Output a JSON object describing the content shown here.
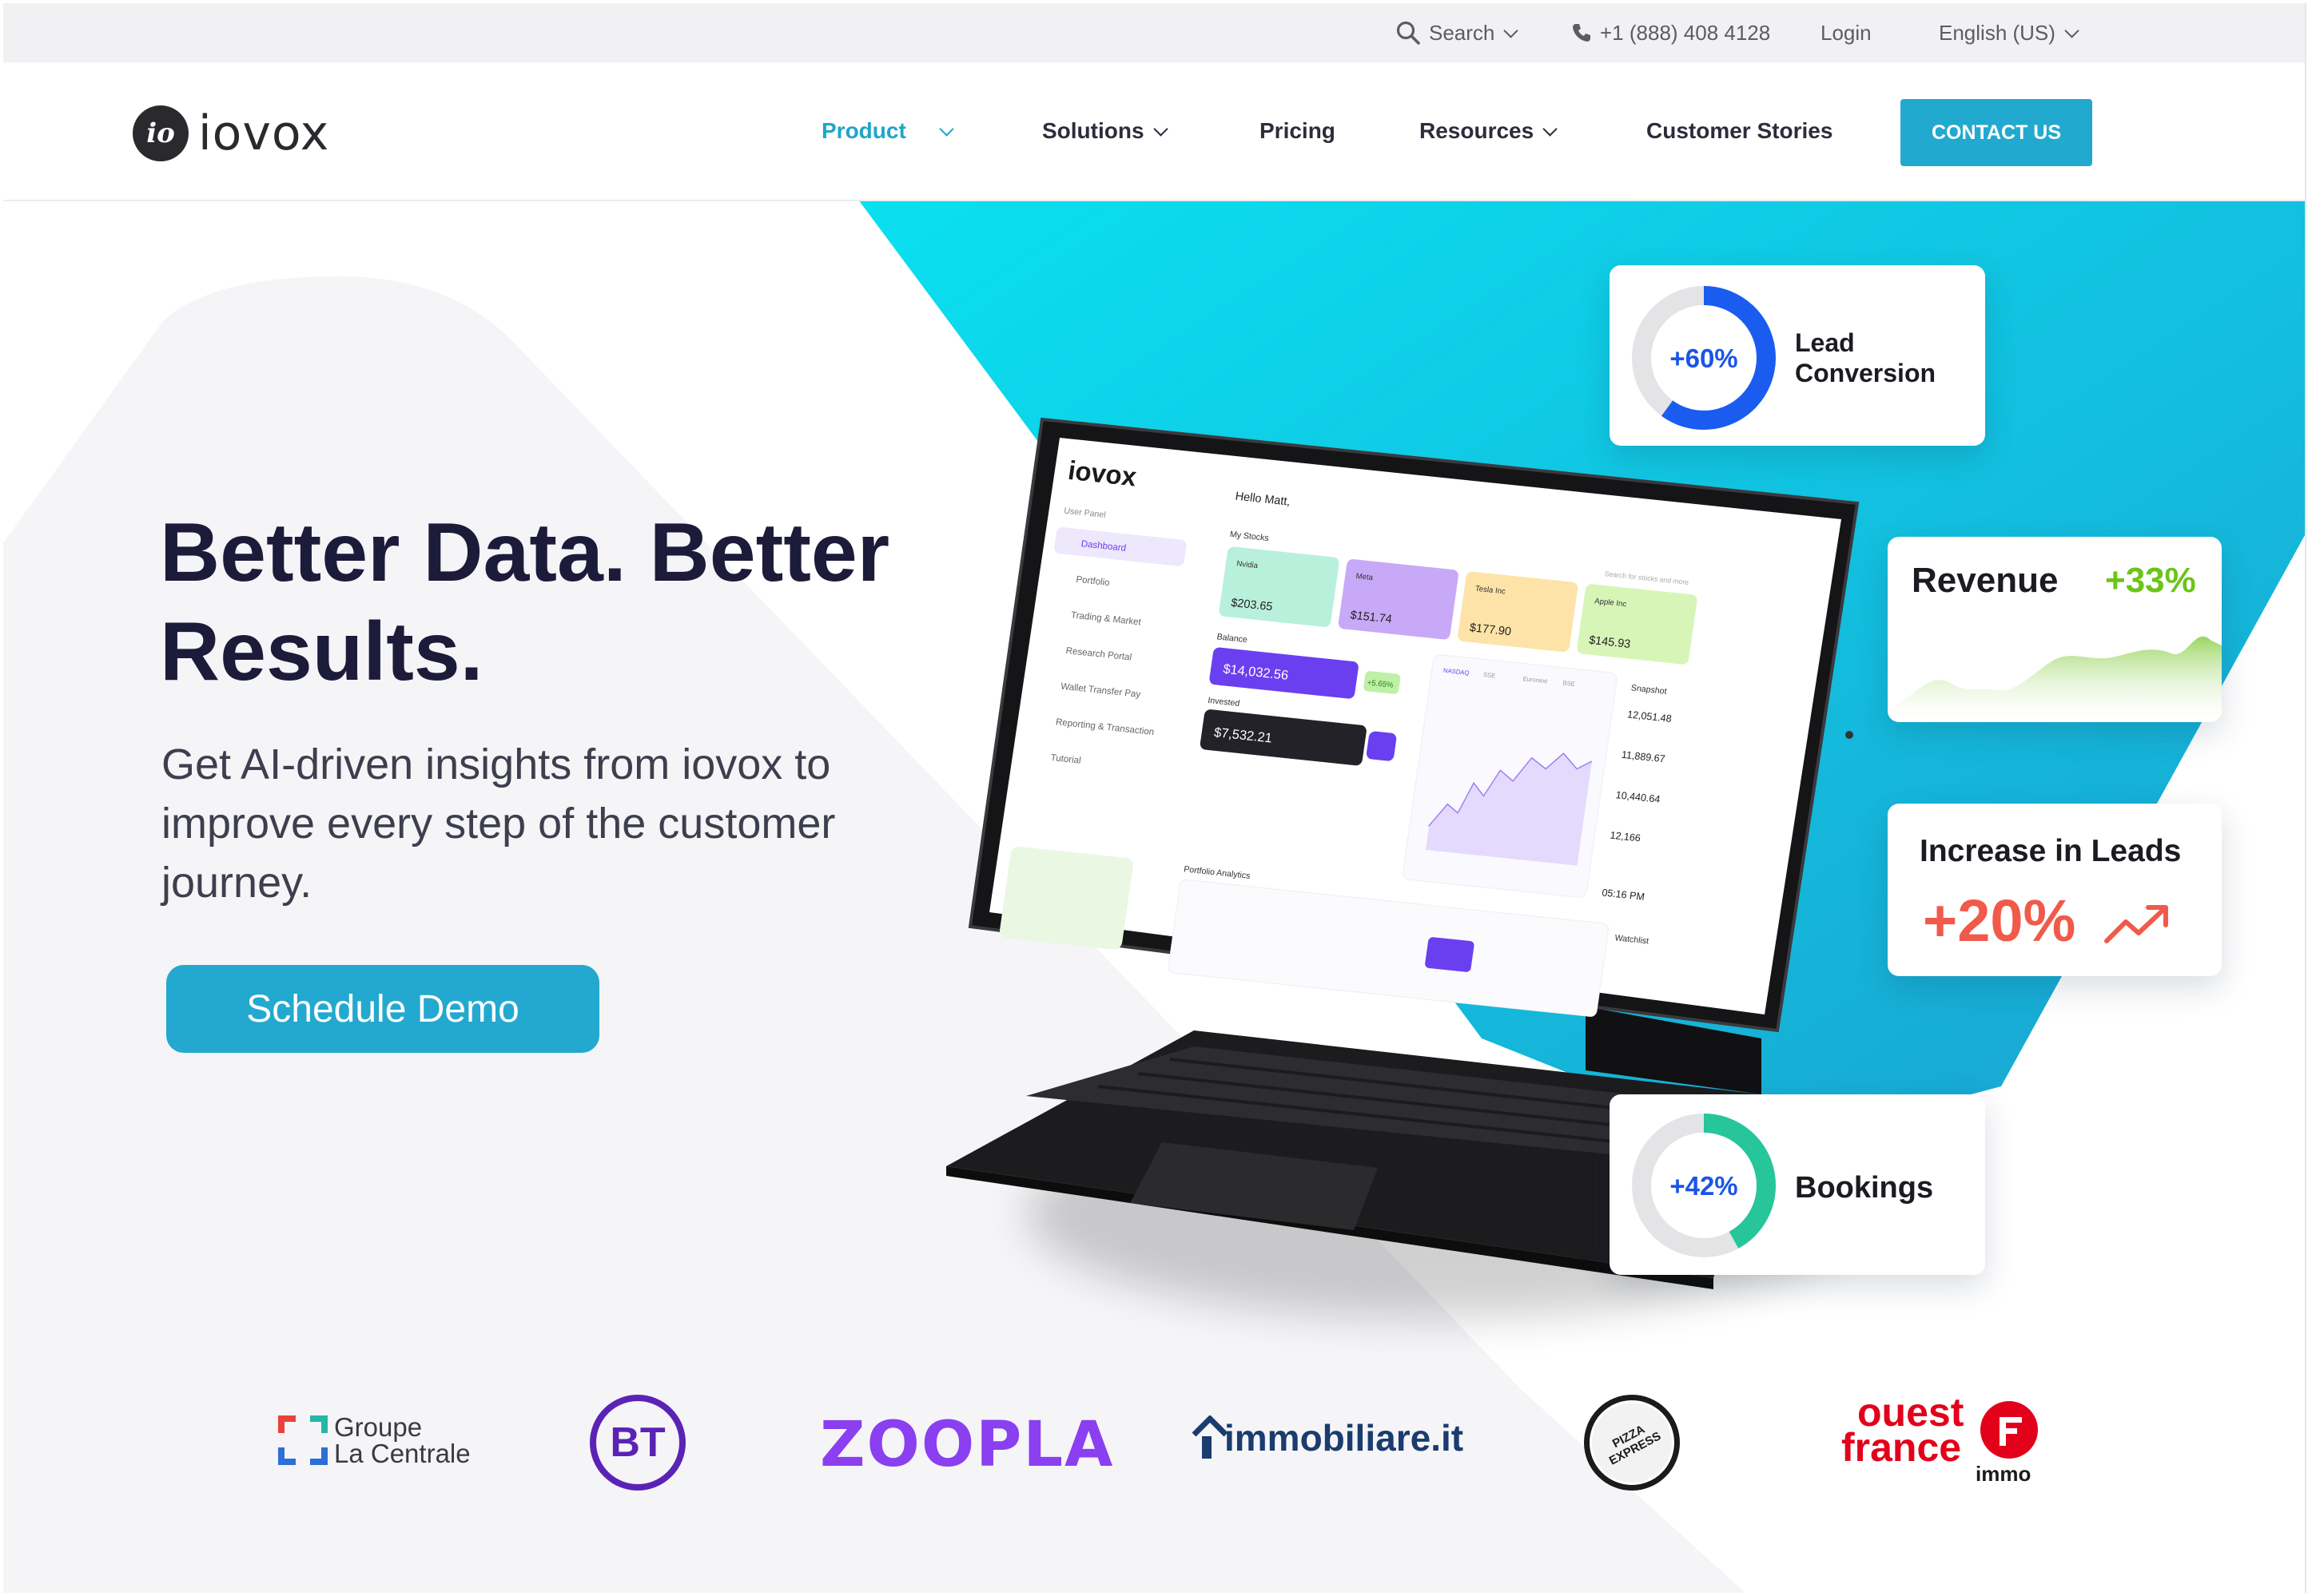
{
  "topbar": {
    "search_label": "Search",
    "phone": "+1 (888) 408 4128",
    "login": "Login",
    "language": "English (US)"
  },
  "brand": {
    "mark": "io",
    "name": "iovox"
  },
  "nav": {
    "product": "Product",
    "solutions": "Solutions",
    "pricing": "Pricing",
    "resources": "Resources",
    "customer_stories": "Customer Stories",
    "contact": "CONTACT US"
  },
  "hero": {
    "headline_line1": "Better Data. Better",
    "headline_line2": "Results.",
    "subhead_line1": "Get AI-driven insights from iovox to",
    "subhead_line2": "improve every step of the customer",
    "subhead_line3": "journey.",
    "cta": "Schedule Demo"
  },
  "stats": {
    "lead_conversion": {
      "value": "+60%",
      "label_line1": "Lead",
      "label_line2": "Conversion",
      "fraction": 0.6,
      "color": "#1a5cf0"
    },
    "revenue": {
      "label": "Revenue",
      "value": "+33%",
      "color": "#6cc417"
    },
    "increase_leads": {
      "label": "Increase in Leads",
      "value": "+20%",
      "color": "#f15a4a"
    },
    "bookings": {
      "value": "+42%",
      "label": "Bookings",
      "fraction": 0.42,
      "color": "#27c59a"
    }
  },
  "tablet": {
    "brand": "iovox",
    "greeting": "Hello Matt,",
    "user_panel": "User Panel",
    "menu": [
      "Dashboard",
      "Portfolio",
      "Trading & Market",
      "Research Portal",
      "Wallet Transfer Pay",
      "Reporting & Transaction",
      "Tutorial"
    ],
    "my_stocks": "My Stocks",
    "search_placeholder": "Search for stocks and more",
    "stocks": [
      {
        "name": "Nvidia",
        "value": "$203.65",
        "color": "#b9f0dc"
      },
      {
        "name": "Meta",
        "value": "$151.74",
        "color": "#c8a9f7"
      },
      {
        "name": "Tesla Inc",
        "value": "$177.90",
        "color": "#fde3a7"
      },
      {
        "name": "Apple Inc",
        "value": "$145.93",
        "color": "#d8f5b8"
      }
    ],
    "balance_label": "Balance",
    "balance_value": "$14,032.56",
    "balance_change": "+5.65%",
    "invested_label": "Invested",
    "invested_value": "$7,532.21",
    "snapshot_label": "Snapshot",
    "snapshot_values": [
      "12,051.48",
      "11,889.67",
      "10,440.64",
      "12,166"
    ],
    "time": "05:16 PM",
    "portfolio_analytics": "Portfolio Analytics",
    "watchlist": "Watchlist",
    "tabs": [
      "NASDAQ",
      "SSE",
      "Euronext",
      "BSE"
    ]
  },
  "clients": {
    "groupe_line1": "Groupe",
    "groupe_line2": "La Centrale",
    "bt": "BT",
    "zoopla": "ZOOPLA",
    "immobiliare": "immobiliare.it",
    "pizza": "PIZZA EXPRESS",
    "ouest_line1": "ouest",
    "ouest_line2": "france",
    "ouest_sub": "immo"
  }
}
